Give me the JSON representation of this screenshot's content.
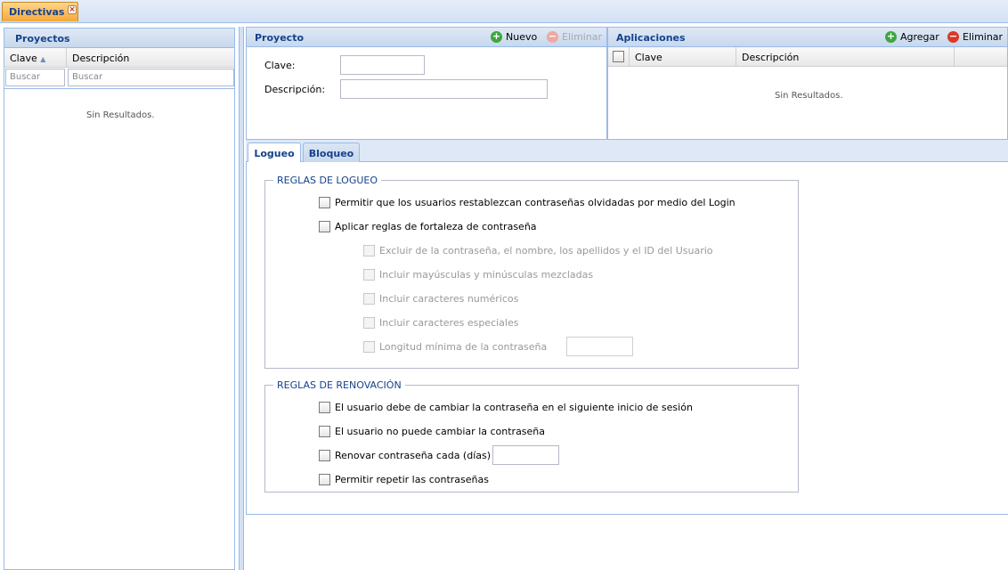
{
  "tabs": {
    "main": "Directivas"
  },
  "proyectos": {
    "title": "Proyectos",
    "columns": [
      "Clave",
      "Descripción"
    ],
    "sort_indicator": "▲",
    "filter_placeholders": [
      "Buscar",
      "Buscar"
    ],
    "empty_text": "Sin Resultados."
  },
  "proyecto": {
    "title": "Proyecto",
    "nuevo": "Nuevo",
    "eliminar": "Eliminar",
    "clave_label": "Clave:",
    "descripcion_label": "Descripción:"
  },
  "aplicaciones": {
    "title": "Aplicaciones",
    "agregar": "Agregar",
    "eliminar": "Eliminar",
    "columns": [
      "Clave",
      "Descripción"
    ],
    "empty_text": "Sin Resultados."
  },
  "subtabs": [
    "Logueo",
    "Bloqueo"
  ],
  "logueo": {
    "legend": "REGLAS DE LOGUEO",
    "options": [
      "Permitir que los usuarios restablezcan contraseñas olvidadas por medio del Login",
      "Aplicar reglas de fortaleza de contraseña"
    ],
    "sub_options": [
      "Excluir de la contraseña, el nombre, los apellidos y el ID del Usuario",
      "Incluir mayúsculas y minúsculas mezcladas",
      "Incluir caracteres numéricos",
      "Incluir caracteres especiales",
      "Longitud mínima de la contraseña"
    ]
  },
  "renovacion": {
    "legend": "REGLAS DE RENOVACIÓN",
    "options": [
      "El usuario debe de cambiar la contraseña en el siguiente inicio de sesión",
      "El usuario no puede cambiar la contraseña",
      "Renovar contraseña cada (días)",
      "Permitir repetir las contraseñas"
    ]
  },
  "icons": {
    "add": "add-circle-icon",
    "remove": "remove-circle-icon",
    "close": "close-icon",
    "sort": "sort-asc-icon"
  },
  "colors": {
    "tab_active": "#f4a93b",
    "header_text": "#15428b",
    "border": "#99bbe8"
  }
}
